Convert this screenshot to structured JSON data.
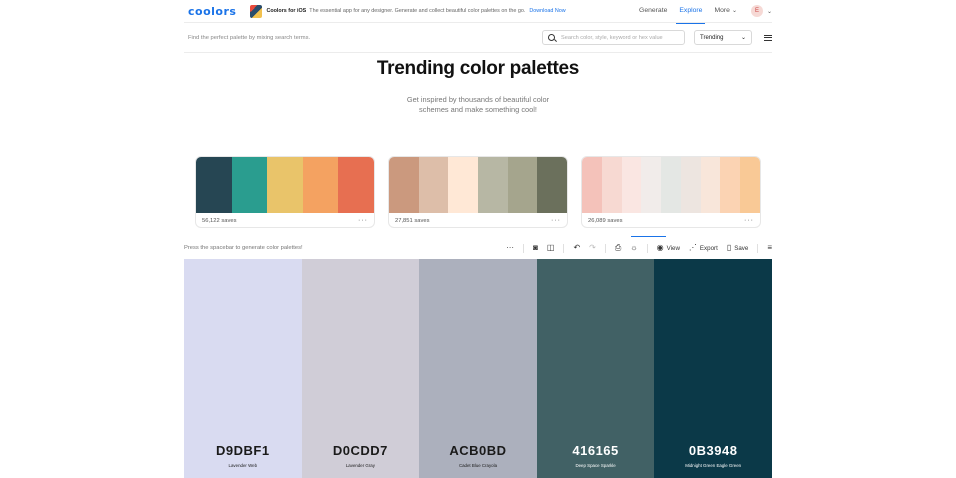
{
  "topbar": {
    "logo": "coolors",
    "ios_title": "Coolors for iOS",
    "ios_text": "The essential app for any designer. Generate and collect beautiful color palettes on the go.",
    "ios_link": "Download Now",
    "nav": [
      "Generate",
      "Explore",
      "More"
    ],
    "active_nav": "Explore",
    "avatar_letter": "E"
  },
  "search": {
    "hint": "Find the perfect palette by mixing search terms.",
    "placeholder": "Search color, style, keyword or hex value",
    "sort_value": "Trending"
  },
  "hero": {
    "title": "Trending color palettes",
    "subtitle_line1": "Get inspired by thousands of beautiful color",
    "subtitle_line2": "schemes and make something cool!"
  },
  "cards": [
    {
      "colors": [
        "#264653",
        "#2A9D8F",
        "#E9C46A",
        "#F4A261",
        "#E76F51"
      ],
      "saves": "56,122 saves"
    },
    {
      "colors": [
        "#CB997E",
        "#DDBEA9",
        "#FFE8D6",
        "#B7B7A4",
        "#A5A58D",
        "#6B705C"
      ],
      "saves": "27,851 saves"
    },
    {
      "colors": [
        "#F4C2BA",
        "#F7D9D2",
        "#FAE6E2",
        "#F1ECEA",
        "#E4E7E4",
        "#EDE5E0",
        "#F8E6DA",
        "#FBD3B3",
        "#F9C996"
      ],
      "saves": "26,089 saves"
    }
  ],
  "generator": {
    "hint": "Press the spacebar to generate color palettes!",
    "view_label": "View",
    "export_label": "Export",
    "save_label": "Save"
  },
  "palette": [
    {
      "hex": "D9DBF1",
      "name": "Lavender Web",
      "bg": "#D9DBF1",
      "fg": "#1a1a1a"
    },
    {
      "hex": "D0CDD7",
      "name": "Lavender Gray",
      "bg": "#D0CDD7",
      "fg": "#1a1a1a"
    },
    {
      "hex": "ACB0BD",
      "name": "Cadet Blue Crayola",
      "bg": "#ACB0BD",
      "fg": "#1a1a1a"
    },
    {
      "hex": "416165",
      "name": "Deep Space Sparkle",
      "bg": "#416165",
      "fg": "#ffffff"
    },
    {
      "hex": "0B3948",
      "name": "Midnight Green Eagle Green",
      "bg": "#0B3948",
      "fg": "#ffffff"
    }
  ]
}
